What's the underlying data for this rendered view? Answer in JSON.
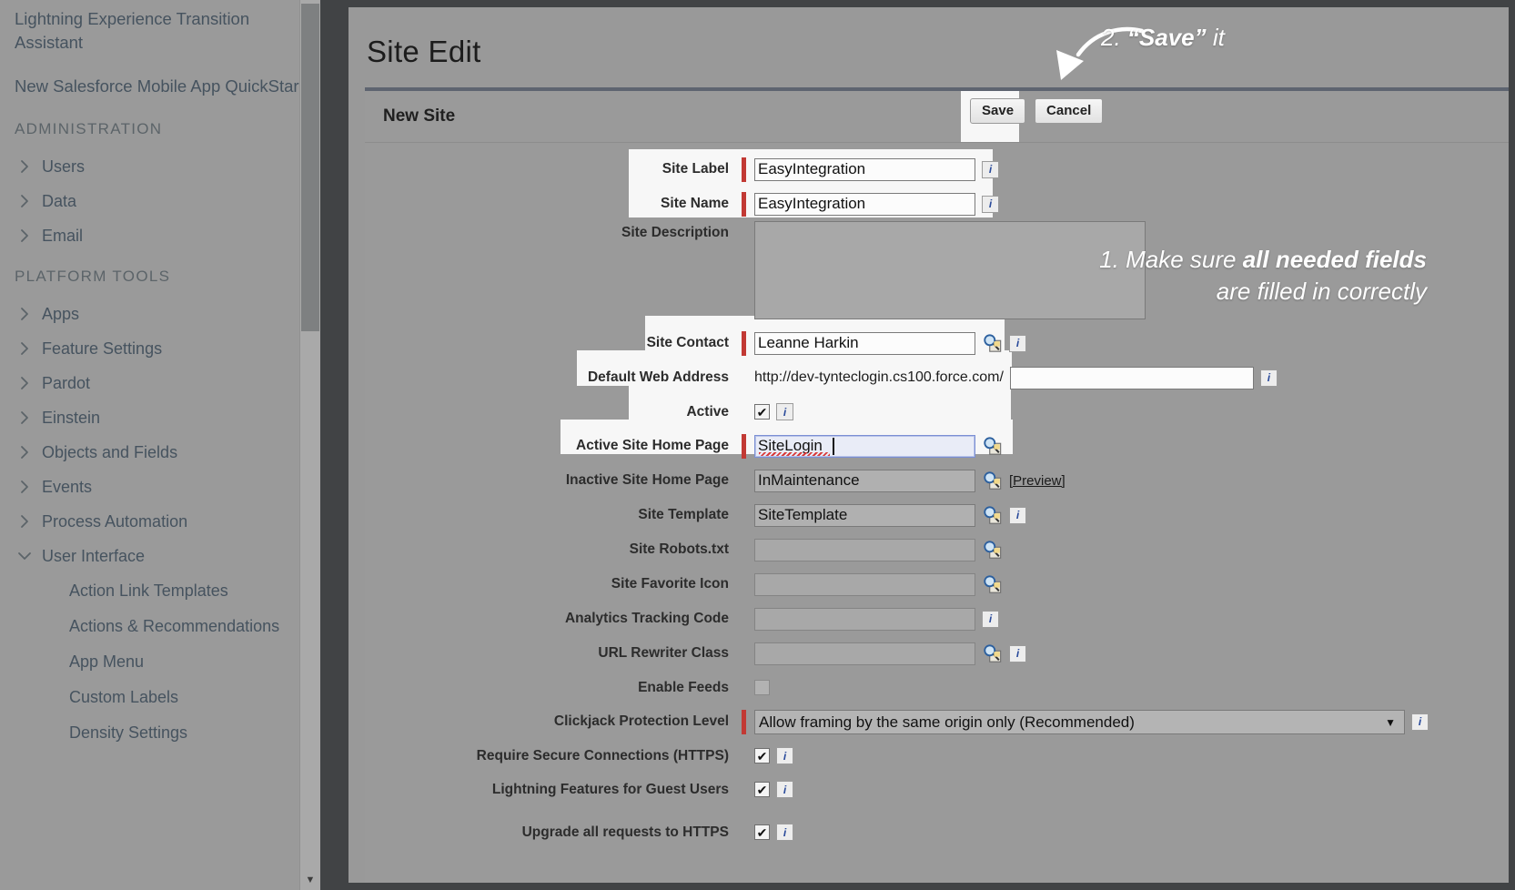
{
  "sidebar": {
    "top_links": [
      "Lightning Experience Transition Assistant",
      "New Salesforce Mobile App QuickStart"
    ],
    "sections": [
      {
        "label": "ADMINISTRATION",
        "items": [
          {
            "label": "Users",
            "icon": "chevron-right-icon",
            "expanded": false
          },
          {
            "label": "Data",
            "icon": "chevron-right-icon",
            "expanded": false
          },
          {
            "label": "Email",
            "icon": "chevron-right-icon",
            "expanded": false
          }
        ]
      },
      {
        "label": "PLATFORM TOOLS",
        "items": [
          {
            "label": "Apps",
            "icon": "chevron-right-icon",
            "expanded": false
          },
          {
            "label": "Feature Settings",
            "icon": "chevron-right-icon",
            "expanded": false
          },
          {
            "label": "Pardot",
            "icon": "chevron-right-icon",
            "expanded": false
          },
          {
            "label": "Einstein",
            "icon": "chevron-right-icon",
            "expanded": false
          },
          {
            "label": "Objects and Fields",
            "icon": "chevron-right-icon",
            "expanded": false
          },
          {
            "label": "Events",
            "icon": "chevron-right-icon",
            "expanded": false
          },
          {
            "label": "Process Automation",
            "icon": "chevron-right-icon",
            "expanded": false
          },
          {
            "label": "User Interface",
            "icon": "chevron-down-icon",
            "expanded": true
          }
        ]
      }
    ],
    "user_interface_children": [
      "Action Link Templates",
      "Actions & Recommendations",
      "App Menu",
      "Custom Labels",
      "Density Settings"
    ]
  },
  "page": {
    "title": "Site Edit",
    "section_title": "New Site"
  },
  "toolbar": {
    "save_label": "Save",
    "cancel_label": "Cancel"
  },
  "form": {
    "site_label": {
      "label": "Site Label",
      "value": "EasyIntegration",
      "required": true
    },
    "site_name": {
      "label": "Site Name",
      "value": "EasyIntegration",
      "required": true
    },
    "site_description": {
      "label": "Site Description",
      "value": ""
    },
    "site_contact": {
      "label": "Site Contact",
      "value": "Leanne Harkin",
      "required": true
    },
    "default_web_address": {
      "label": "Default Web Address",
      "prefix": "http://dev-tynteclogin.cs100.force.com/",
      "value": ""
    },
    "active": {
      "label": "Active",
      "checked": true
    },
    "active_site_home_page": {
      "label": "Active Site Home Page",
      "value": "SiteLogin",
      "required": true,
      "focused": true
    },
    "inactive_site_home_page": {
      "label": "Inactive Site Home Page",
      "value": "InMaintenance",
      "preview_label": "[Preview]"
    },
    "site_template": {
      "label": "Site Template",
      "value": "SiteTemplate"
    },
    "site_robots": {
      "label": "Site Robots.txt",
      "value": ""
    },
    "site_favorite_icon": {
      "label": "Site Favorite Icon",
      "value": ""
    },
    "analytics_tracking_code": {
      "label": "Analytics Tracking Code",
      "value": ""
    },
    "url_rewriter_class": {
      "label": "URL Rewriter Class",
      "value": ""
    },
    "enable_feeds": {
      "label": "Enable Feeds",
      "checked": false
    },
    "clickjack": {
      "label": "Clickjack Protection Level",
      "value": "Allow framing by the same origin only (Recommended)",
      "required": true
    },
    "require_https": {
      "label": "Require Secure Connections (HTTPS)",
      "checked": true
    },
    "lightning_guest": {
      "label": "Lightning Features for Guest Users",
      "checked": true
    },
    "upgrade_https": {
      "label": "Upgrade all requests to HTTPS",
      "checked": true
    }
  },
  "annotations": {
    "step1_prefix": "1. Make sure ",
    "step1_bold": "all needed fields",
    "step1_line2": "are filled in correctly",
    "step2_prefix": "2. ",
    "step2_bold": "“Save”",
    "step2_suffix": " it"
  },
  "colors": {
    "required_bar": "#c23934",
    "spotlight": "#f7f7f7",
    "panel_accent": "#5e6470",
    "info_icon": "#2a4b9b"
  }
}
